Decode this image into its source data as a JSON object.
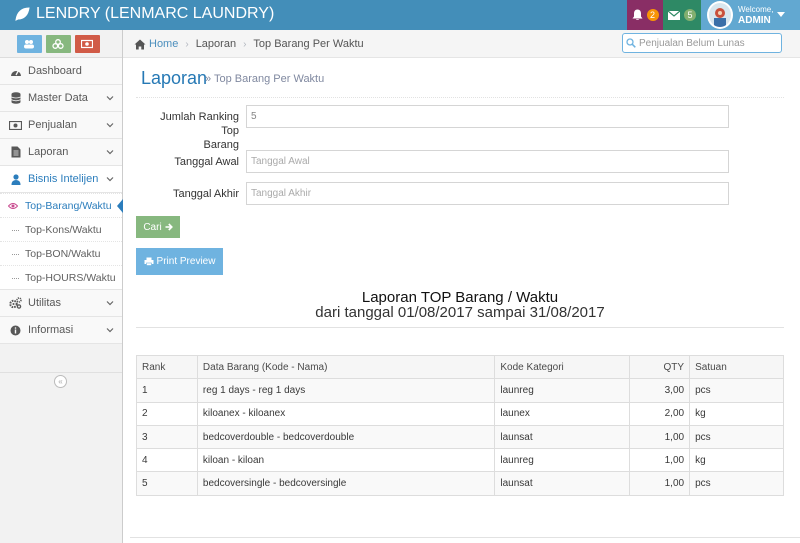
{
  "navbar": {
    "brand": "LENDRY (LENMARC LAUNDRY)",
    "notifications_count": "2",
    "messages_count": "5",
    "welcome": "Welcome,",
    "user_name": "ADMIN"
  },
  "sidebar": {
    "shortcuts": [
      "users-icon",
      "group-icon",
      "money-icon"
    ],
    "items": [
      {
        "label": "Dashboard",
        "icon": "dashboard-icon"
      },
      {
        "label": "Master Data",
        "icon": "database-icon"
      },
      {
        "label": "Penjualan",
        "icon": "money-icon"
      },
      {
        "label": "Laporan",
        "icon": "file-icon"
      },
      {
        "label": "Bisnis Intelijen",
        "icon": "user-icon"
      },
      {
        "label": "Utilitas",
        "icon": "cogs-icon"
      },
      {
        "label": "Informasi",
        "icon": "info-icon"
      }
    ],
    "submenu": [
      {
        "label": "Top-Barang/Waktu",
        "active": true
      },
      {
        "label": "Top-Kons/Waktu"
      },
      {
        "label": "Top-BON/Waktu"
      },
      {
        "label": "Top-HOURS/Waktu"
      }
    ]
  },
  "breadcrumb": {
    "home": "Home",
    "items": [
      "Laporan",
      "Top Barang Per Waktu"
    ]
  },
  "search": {
    "placeholder": "Penjualan Belum Lunas"
  },
  "page": {
    "title": "Laporan",
    "subtitle": "» Top Barang Per Waktu"
  },
  "form": {
    "ranking_label_1": "Jumlah Ranking Top",
    "ranking_label_2": "Barang",
    "ranking_value": "5",
    "start_label": "Tanggal Awal",
    "start_placeholder": "Tanggal Awal",
    "end_label": "Tanggal Akhir",
    "end_placeholder": "Tanggal Akhir",
    "search_button": "Cari",
    "print_button": "Print Preview"
  },
  "report": {
    "title": "Laporan TOP Barang / Waktu",
    "range": "dari tanggal 01/08/2017 sampai 31/08/2017",
    "columns": [
      "Rank",
      "Data Barang (Kode - Nama)",
      "Kode Kategori",
      "QTY",
      "Satuan"
    ],
    "rows": [
      [
        "1",
        "reg 1 days - reg 1 days",
        "launreg",
        "3,00",
        "pcs"
      ],
      [
        "2",
        "kiloanex - kiloanex",
        "launex",
        "2,00",
        "kg"
      ],
      [
        "3",
        "bedcoverdouble - bedcoverdouble",
        "launsat",
        "1,00",
        "pcs"
      ],
      [
        "4",
        "kiloan - kiloan",
        "launreg",
        "1,00",
        "kg"
      ],
      [
        "5",
        "bedcoversingle - bedcoversingle",
        "launsat",
        "1,00",
        "pcs"
      ]
    ]
  },
  "colors": {
    "navbar": "#438eb9",
    "accent": "#2b7dbc",
    "success": "#87b87f",
    "info": "#6fb3e0",
    "danger": "#d15b47"
  }
}
